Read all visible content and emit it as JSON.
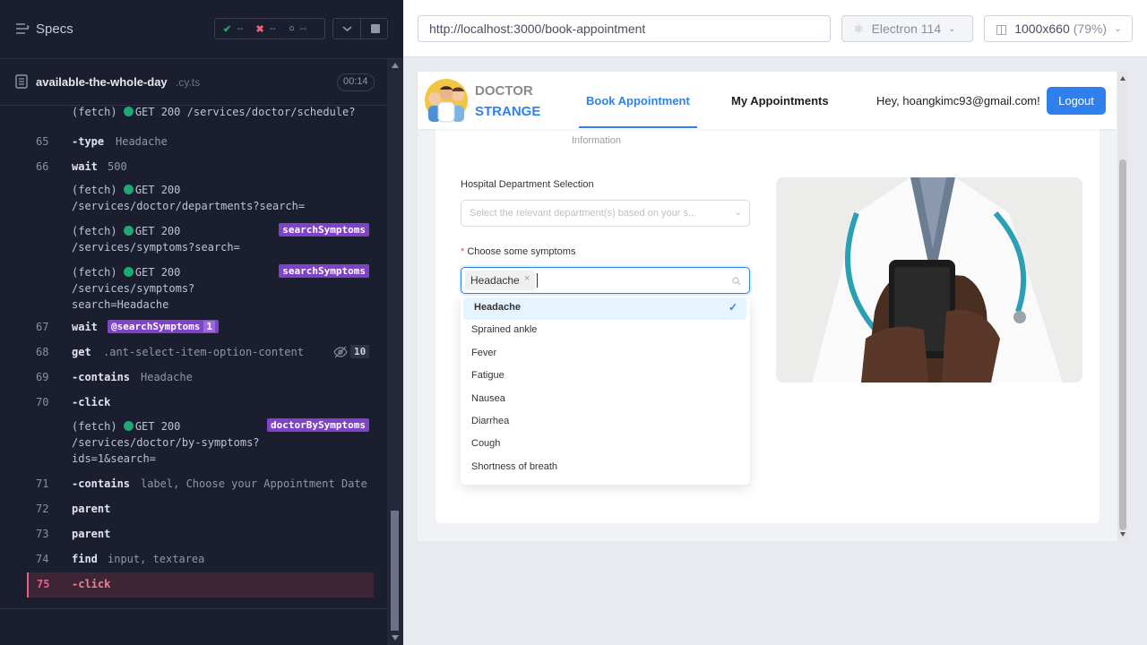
{
  "runner": {
    "specs_title": "Specs",
    "stats": {
      "passed": "--",
      "failed": "--",
      "pending": "--"
    },
    "file_name": "available-the-whole-day",
    "file_ext": ".cy.ts",
    "duration": "00:14"
  },
  "commands": [
    {
      "line": "",
      "kind": "fetch",
      "text": "(fetch)",
      "status": "GET 200",
      "url": "/services/doctor/schedule?"
    },
    {
      "line": "65",
      "kind": "cmd",
      "name": "-type",
      "arg": "Headache"
    },
    {
      "line": "66",
      "kind": "cmd",
      "name": "wait",
      "arg": "500"
    },
    {
      "line": "",
      "kind": "fetch",
      "text": "(fetch)",
      "status": "GET 200",
      "url": "/services/doctor/departments?search="
    },
    {
      "line": "",
      "kind": "fetch",
      "text": "(fetch)",
      "status": "GET 200",
      "url": "/services/symptoms?search=",
      "alias": "searchSymptoms"
    },
    {
      "line": "",
      "kind": "fetch",
      "text": "(fetch)",
      "status": "GET 200",
      "url1": "/services/symptoms?",
      "url2": "search=Headache",
      "alias": "searchSymptoms"
    },
    {
      "line": "67",
      "kind": "cmd",
      "name": "wait",
      "alias_arg": "@searchSymptoms",
      "alias_count": "1"
    },
    {
      "line": "68",
      "kind": "cmd",
      "name": "get",
      "arg": ".ant-select-item-option-content",
      "count": "10"
    },
    {
      "line": "69",
      "kind": "cmd",
      "name": "-contains",
      "arg": "Headache"
    },
    {
      "line": "70",
      "kind": "cmd",
      "name": "-click",
      "arg": ""
    },
    {
      "line": "",
      "kind": "fetch",
      "text": "(fetch)",
      "status": "GET 200",
      "url1": "/services/doctor/by-symptoms?",
      "url2": "ids=1&search=",
      "alias": "doctorBySymptoms"
    },
    {
      "line": "71",
      "kind": "cmd",
      "name": "-contains",
      "arg": "label, Choose your Appointment Date"
    },
    {
      "line": "72",
      "kind": "cmd",
      "name": "parent",
      "arg": ""
    },
    {
      "line": "73",
      "kind": "cmd",
      "name": "parent",
      "arg": ""
    },
    {
      "line": "74",
      "kind": "cmd",
      "name": "find",
      "arg": "input, textarea"
    },
    {
      "line": "75",
      "kind": "cmd",
      "name": "-click",
      "arg": ""
    }
  ],
  "browser": {
    "url": "http://localhost:3000/book-appointment",
    "browser_name": "Electron 114",
    "viewport": "1000x660",
    "zoom": "(79%)"
  },
  "app": {
    "logo_line1": "DOCTOR",
    "logo_line2": "STRANGE",
    "nav_book": "Book Appointment",
    "nav_my": "My Appointments",
    "greeting": "Hey, hoangkimc93@gmail.com!",
    "logout": "Logout",
    "step_label": "Information",
    "dept_label": "Hospital Department Selection",
    "dept_placeholder": "Select the relevant department(s) based on your s...",
    "symptoms_label": "Choose some symptoms",
    "required_mark": "*",
    "selected_tag": "Headache",
    "options": [
      "Headache",
      "Sprained ankle",
      "Fever",
      "Fatigue",
      "Nausea",
      "Diarrhea",
      "Cough",
      "Shortness of breath"
    ],
    "selected_option": "Headache"
  },
  "colors": {
    "accent": "#1677ff",
    "logout_bg": "#2f80ed",
    "runner_bg": "#1b1e2e",
    "alias_purple": "#7f43c9",
    "active_line": "#ef5f80"
  }
}
